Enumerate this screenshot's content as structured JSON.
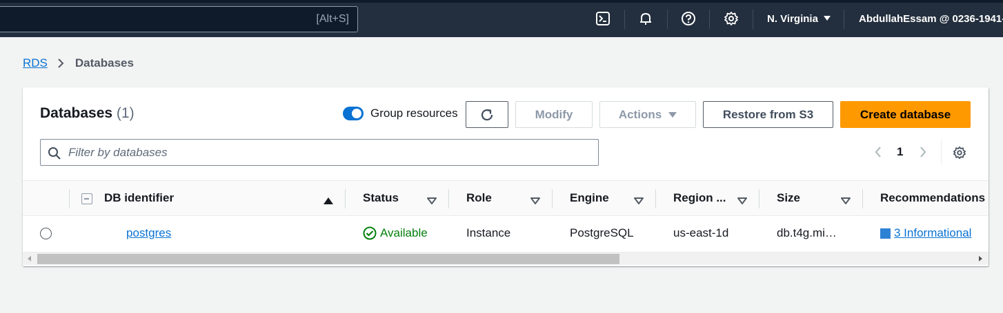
{
  "topnav": {
    "search_shortcut": "[Alt+S]",
    "icons": [
      "cloudshell-icon",
      "bell-icon",
      "help-icon",
      "settings-gear-icon"
    ],
    "region": "N. Virginia",
    "account": "AbdullahEssam @ 0236-1941-"
  },
  "breadcrumb": {
    "root": "RDS",
    "current": "Databases"
  },
  "panel": {
    "title": "Databases",
    "count": "(1)",
    "group_resources_label": "Group resources",
    "group_resources_on": true,
    "modify_label": "Modify",
    "actions_label": "Actions",
    "restore_label": "Restore from S3",
    "create_label": "Create database",
    "filter_placeholder": "Filter by databases",
    "page": "1"
  },
  "table": {
    "columns": [
      "DB identifier",
      "Status",
      "Role",
      "Engine",
      "Region ...",
      "Size",
      "Recommendations"
    ],
    "row": {
      "identifier": "postgres",
      "status": "Available",
      "role": "Instance",
      "engine": "PostgreSQL",
      "region": "us-east-1d",
      "size": "db.t4g.mi…",
      "recommendations": "3 Informational"
    }
  },
  "colors": {
    "nav_bg": "#232f3e",
    "link": "#0972d3",
    "primary": "#ff9900",
    "success": "#037f0c"
  }
}
